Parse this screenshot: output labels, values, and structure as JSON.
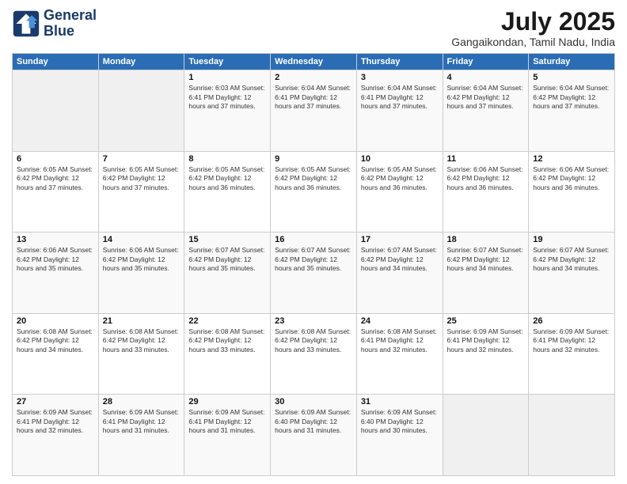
{
  "header": {
    "logo_line1": "General",
    "logo_line2": "Blue",
    "month": "July 2025",
    "location": "Gangaikondan, Tamil Nadu, India"
  },
  "days_of_week": [
    "Sunday",
    "Monday",
    "Tuesday",
    "Wednesday",
    "Thursday",
    "Friday",
    "Saturday"
  ],
  "weeks": [
    [
      {
        "day": "",
        "info": ""
      },
      {
        "day": "",
        "info": ""
      },
      {
        "day": "1",
        "info": "Sunrise: 6:03 AM\nSunset: 6:41 PM\nDaylight: 12 hours and 37 minutes."
      },
      {
        "day": "2",
        "info": "Sunrise: 6:04 AM\nSunset: 6:41 PM\nDaylight: 12 hours and 37 minutes."
      },
      {
        "day": "3",
        "info": "Sunrise: 6:04 AM\nSunset: 6:41 PM\nDaylight: 12 hours and 37 minutes."
      },
      {
        "day": "4",
        "info": "Sunrise: 6:04 AM\nSunset: 6:42 PM\nDaylight: 12 hours and 37 minutes."
      },
      {
        "day": "5",
        "info": "Sunrise: 6:04 AM\nSunset: 6:42 PM\nDaylight: 12 hours and 37 minutes."
      }
    ],
    [
      {
        "day": "6",
        "info": "Sunrise: 6:05 AM\nSunset: 6:42 PM\nDaylight: 12 hours and 37 minutes."
      },
      {
        "day": "7",
        "info": "Sunrise: 6:05 AM\nSunset: 6:42 PM\nDaylight: 12 hours and 37 minutes."
      },
      {
        "day": "8",
        "info": "Sunrise: 6:05 AM\nSunset: 6:42 PM\nDaylight: 12 hours and 36 minutes."
      },
      {
        "day": "9",
        "info": "Sunrise: 6:05 AM\nSunset: 6:42 PM\nDaylight: 12 hours and 36 minutes."
      },
      {
        "day": "10",
        "info": "Sunrise: 6:05 AM\nSunset: 6:42 PM\nDaylight: 12 hours and 36 minutes."
      },
      {
        "day": "11",
        "info": "Sunrise: 6:06 AM\nSunset: 6:42 PM\nDaylight: 12 hours and 36 minutes."
      },
      {
        "day": "12",
        "info": "Sunrise: 6:06 AM\nSunset: 6:42 PM\nDaylight: 12 hours and 36 minutes."
      }
    ],
    [
      {
        "day": "13",
        "info": "Sunrise: 6:06 AM\nSunset: 6:42 PM\nDaylight: 12 hours and 35 minutes."
      },
      {
        "day": "14",
        "info": "Sunrise: 6:06 AM\nSunset: 6:42 PM\nDaylight: 12 hours and 35 minutes."
      },
      {
        "day": "15",
        "info": "Sunrise: 6:07 AM\nSunset: 6:42 PM\nDaylight: 12 hours and 35 minutes."
      },
      {
        "day": "16",
        "info": "Sunrise: 6:07 AM\nSunset: 6:42 PM\nDaylight: 12 hours and 35 minutes."
      },
      {
        "day": "17",
        "info": "Sunrise: 6:07 AM\nSunset: 6:42 PM\nDaylight: 12 hours and 34 minutes."
      },
      {
        "day": "18",
        "info": "Sunrise: 6:07 AM\nSunset: 6:42 PM\nDaylight: 12 hours and 34 minutes."
      },
      {
        "day": "19",
        "info": "Sunrise: 6:07 AM\nSunset: 6:42 PM\nDaylight: 12 hours and 34 minutes."
      }
    ],
    [
      {
        "day": "20",
        "info": "Sunrise: 6:08 AM\nSunset: 6:42 PM\nDaylight: 12 hours and 34 minutes."
      },
      {
        "day": "21",
        "info": "Sunrise: 6:08 AM\nSunset: 6:42 PM\nDaylight: 12 hours and 33 minutes."
      },
      {
        "day": "22",
        "info": "Sunrise: 6:08 AM\nSunset: 6:42 PM\nDaylight: 12 hours and 33 minutes."
      },
      {
        "day": "23",
        "info": "Sunrise: 6:08 AM\nSunset: 6:42 PM\nDaylight: 12 hours and 33 minutes."
      },
      {
        "day": "24",
        "info": "Sunrise: 6:08 AM\nSunset: 6:41 PM\nDaylight: 12 hours and 32 minutes."
      },
      {
        "day": "25",
        "info": "Sunrise: 6:09 AM\nSunset: 6:41 PM\nDaylight: 12 hours and 32 minutes."
      },
      {
        "day": "26",
        "info": "Sunrise: 6:09 AM\nSunset: 6:41 PM\nDaylight: 12 hours and 32 minutes."
      }
    ],
    [
      {
        "day": "27",
        "info": "Sunrise: 6:09 AM\nSunset: 6:41 PM\nDaylight: 12 hours and 32 minutes."
      },
      {
        "day": "28",
        "info": "Sunrise: 6:09 AM\nSunset: 6:41 PM\nDaylight: 12 hours and 31 minutes."
      },
      {
        "day": "29",
        "info": "Sunrise: 6:09 AM\nSunset: 6:41 PM\nDaylight: 12 hours and 31 minutes."
      },
      {
        "day": "30",
        "info": "Sunrise: 6:09 AM\nSunset: 6:40 PM\nDaylight: 12 hours and 31 minutes."
      },
      {
        "day": "31",
        "info": "Sunrise: 6:09 AM\nSunset: 6:40 PM\nDaylight: 12 hours and 30 minutes."
      },
      {
        "day": "",
        "info": ""
      },
      {
        "day": "",
        "info": ""
      }
    ]
  ]
}
